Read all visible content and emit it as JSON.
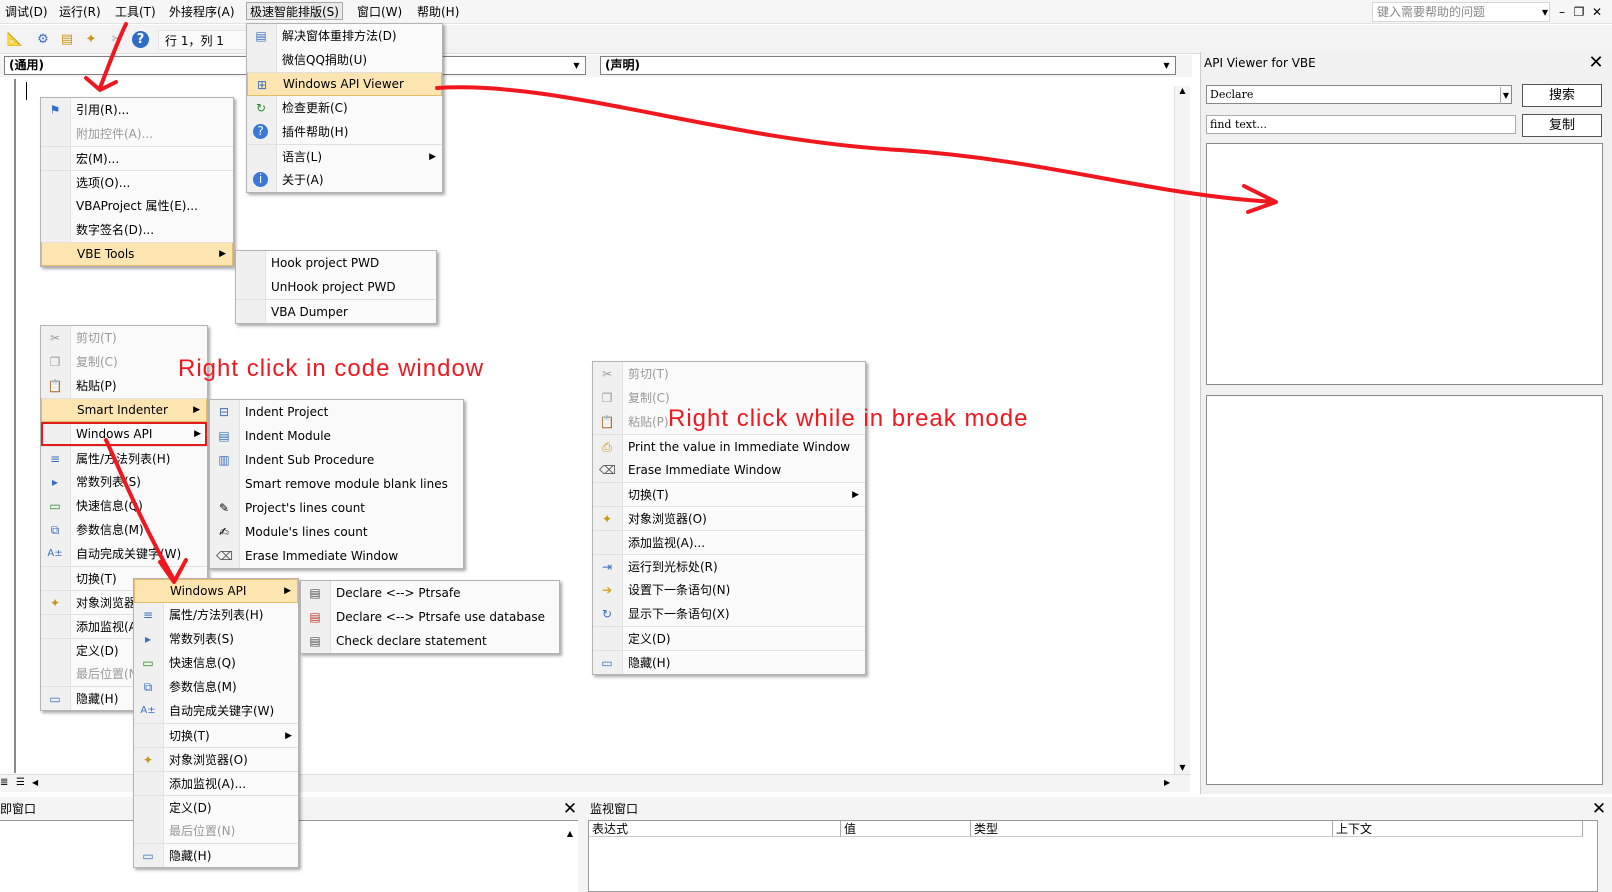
{
  "menubar": {
    "items": [
      "调试(D)",
      "运行(R)",
      "工具(T)",
      "外接程序(A)",
      "极速智能排版(S)",
      "窗口(W)",
      "帮助(H)"
    ],
    "help_placeholder": "键入需要帮助的问题"
  },
  "toolbar": {
    "position": "行 1，列 1",
    "icons": [
      "design-mode-icon",
      "project-icon",
      "properties-icon",
      "object-browser-icon",
      "toolbox-icon",
      "help-icon"
    ]
  },
  "code_window": {
    "object_combo": "(通用)",
    "proc_combo": "(声明)"
  },
  "api_viewer": {
    "title": "API Viewer for VBE",
    "type_select": "Declare",
    "search_placeholder": "find text...",
    "search_button": "搜索",
    "copy_button": "复制"
  },
  "immediate_window": {
    "title": "立即窗口"
  },
  "watch_window": {
    "title": "监视窗口",
    "columns": [
      "表达式",
      "值",
      "类型",
      "上下文"
    ]
  },
  "menus": {
    "plugin_menu": [
      {
        "label": "解决窗体重排方法(D)",
        "icon": "form-icon"
      },
      {
        "label": "微信QQ捐助(U)",
        "icon": ""
      },
      {
        "label": "Windows API Viewer",
        "icon": "api-viewer-icon"
      },
      {
        "label": "检查更新(C)",
        "icon": "update-icon"
      },
      {
        "label": "插件帮助(H)",
        "icon": "help-icon"
      },
      {
        "label": "语言(L)",
        "icon": ""
      },
      {
        "label": "关于(A)",
        "icon": "info-icon"
      }
    ],
    "tools_menu": [
      {
        "label": "引用(R)...",
        "icon": "references-icon"
      },
      {
        "label": "附加控件(A)...",
        "icon": ""
      },
      {
        "label": "宏(M)...",
        "icon": ""
      },
      {
        "label": "选项(O)...",
        "icon": ""
      },
      {
        "label": "VBAProject 属性(E)...",
        "icon": ""
      },
      {
        "label": "数字签名(D)...",
        "icon": ""
      },
      {
        "label": "VBE Tools",
        "icon": ""
      }
    ],
    "vbe_tools_sub": [
      "Hook project PWD",
      "UnHook project PWD",
      "VBA Dumper"
    ],
    "context_menu": [
      {
        "label": "剪切(T)",
        "icon": "cut-icon"
      },
      {
        "label": "复制(C)",
        "icon": "copy-icon"
      },
      {
        "label": "粘贴(P)",
        "icon": "paste-icon"
      },
      {
        "label": "Smart Indenter",
        "icon": ""
      },
      {
        "label": "Windows API",
        "icon": ""
      },
      {
        "label": "属性/方法列表(H)",
        "icon": "list-icon"
      },
      {
        "label": "常数列表(S)",
        "icon": "constant-icon"
      },
      {
        "label": "快速信息(Q)",
        "icon": "quickinfo-icon"
      },
      {
        "label": "参数信息(M)",
        "icon": "paraminfo-icon"
      },
      {
        "label": "自动完成关键字(W)",
        "icon": "autocomplete-icon"
      },
      {
        "label": "切换(T)",
        "icon": ""
      },
      {
        "label": "对象浏览器(O)",
        "icon": "object-browser-icon"
      },
      {
        "label": "添加监视(A)...",
        "icon": ""
      },
      {
        "label": "定义(D)",
        "icon": ""
      },
      {
        "label": "最后位置(N)",
        "icon": ""
      },
      {
        "label": "隐藏(H)",
        "icon": "hide-icon"
      }
    ],
    "indenter_sub": [
      {
        "label": "Indent Project",
        "icon": "indent-project-icon"
      },
      {
        "label": "Indent Module",
        "icon": "indent-module-icon"
      },
      {
        "label": "Indent Sub Procedure",
        "icon": "indent-sub-icon"
      },
      {
        "label": "Smart remove module blank lines",
        "icon": ""
      },
      {
        "label": "Project's lines count",
        "icon": "count-project-icon"
      },
      {
        "label": "Module's lines count",
        "icon": "count-module-icon"
      },
      {
        "label": "Erase Immediate Window",
        "icon": "eraser-icon"
      }
    ],
    "context_menu2": [
      {
        "label": "Windows API",
        "icon": ""
      },
      {
        "label": "属性/方法列表(H)",
        "icon": "list-icon"
      },
      {
        "label": "常数列表(S)",
        "icon": "constant-icon"
      },
      {
        "label": "快速信息(Q)",
        "icon": "quickinfo-icon"
      },
      {
        "label": "参数信息(M)",
        "icon": "paraminfo-icon"
      },
      {
        "label": "自动完成关键字(W)",
        "icon": "autocomplete-icon"
      },
      {
        "label": "切换(T)",
        "icon": ""
      },
      {
        "label": "对象浏览器(O)",
        "icon": "object-browser-icon"
      },
      {
        "label": "添加监视(A)...",
        "icon": ""
      },
      {
        "label": "定义(D)",
        "icon": ""
      },
      {
        "label": "最后位置(N)",
        "icon": ""
      },
      {
        "label": "隐藏(H)",
        "icon": "hide-icon"
      }
    ],
    "windows_api_sub": [
      "Declare <--> Ptrsafe",
      "Declare <--> Ptrsafe use database",
      "Check declare statement"
    ],
    "break_menu": [
      {
        "label": "剪切(T)",
        "icon": "cut-icon"
      },
      {
        "label": "复制(C)",
        "icon": "copy-icon"
      },
      {
        "label": "粘贴(P)",
        "icon": "paste-icon"
      },
      {
        "label": "Print the value in Immediate Window",
        "icon": "print-icon"
      },
      {
        "label": "Erase Immediate Window",
        "icon": "eraser-icon"
      },
      {
        "label": "切换(T)",
        "icon": ""
      },
      {
        "label": "对象浏览器(O)",
        "icon": "object-browser-icon"
      },
      {
        "label": "添加监视(A)...",
        "icon": ""
      },
      {
        "label": "运行到光标处(R)",
        "icon": "run-to-cursor-icon"
      },
      {
        "label": "设置下一条语句(N)",
        "icon": "set-next-icon"
      },
      {
        "label": "显示下一条语句(X)",
        "icon": "show-next-icon"
      },
      {
        "label": "定义(D)",
        "icon": ""
      },
      {
        "label": "隐藏(H)",
        "icon": "hide-icon"
      }
    ]
  },
  "annotations": {
    "code_window": "Right click in code window",
    "break_mode": "Right click while in break mode",
    "color": "#f0171f"
  }
}
